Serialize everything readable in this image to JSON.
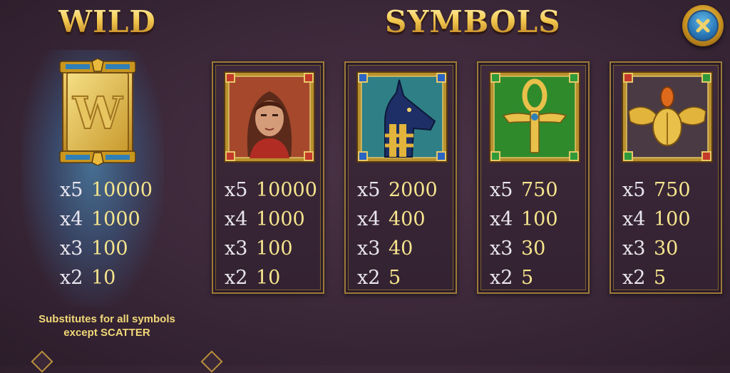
{
  "headings": {
    "wild": "WILD",
    "symbols": "SYMBOLS"
  },
  "close_button": {
    "icon": "close-icon"
  },
  "wild": {
    "tile_letter": "W",
    "payouts": [
      {
        "mult": "x5",
        "value": "10000"
      },
      {
        "mult": "x4",
        "value": "1000"
      },
      {
        "mult": "x3",
        "value": "100"
      },
      {
        "mult": "x2",
        "value": "10"
      }
    ],
    "description_line1": "Substitutes for all symbols",
    "description_line2": "except SCATTER"
  },
  "symbols": [
    {
      "icon": "explorer-woman-icon",
      "payouts": [
        {
          "mult": "x5",
          "value": "10000"
        },
        {
          "mult": "x4",
          "value": "1000"
        },
        {
          "mult": "x3",
          "value": "100"
        },
        {
          "mult": "x2",
          "value": "10"
        }
      ]
    },
    {
      "icon": "anubis-icon",
      "payouts": [
        {
          "mult": "x5",
          "value": "2000"
        },
        {
          "mult": "x4",
          "value": "400"
        },
        {
          "mult": "x3",
          "value": "40"
        },
        {
          "mult": "x2",
          "value": "5"
        }
      ]
    },
    {
      "icon": "ankh-icon",
      "payouts": [
        {
          "mult": "x5",
          "value": "750"
        },
        {
          "mult": "x4",
          "value": "100"
        },
        {
          "mult": "x3",
          "value": "30"
        },
        {
          "mult": "x2",
          "value": "5"
        }
      ]
    },
    {
      "icon": "scarab-icon",
      "payouts": [
        {
          "mult": "x5",
          "value": "750"
        },
        {
          "mult": "x4",
          "value": "100"
        },
        {
          "mult": "x3",
          "value": "30"
        },
        {
          "mult": "x2",
          "value": "5"
        }
      ]
    }
  ],
  "colors": {
    "background": "#3a2738",
    "gold": "#f3c950",
    "payout_value": "#f6e58d",
    "multiplier": "#e9e6ef",
    "wild_glow": "#50aadc",
    "close_button_blue": "#2a78b8"
  }
}
